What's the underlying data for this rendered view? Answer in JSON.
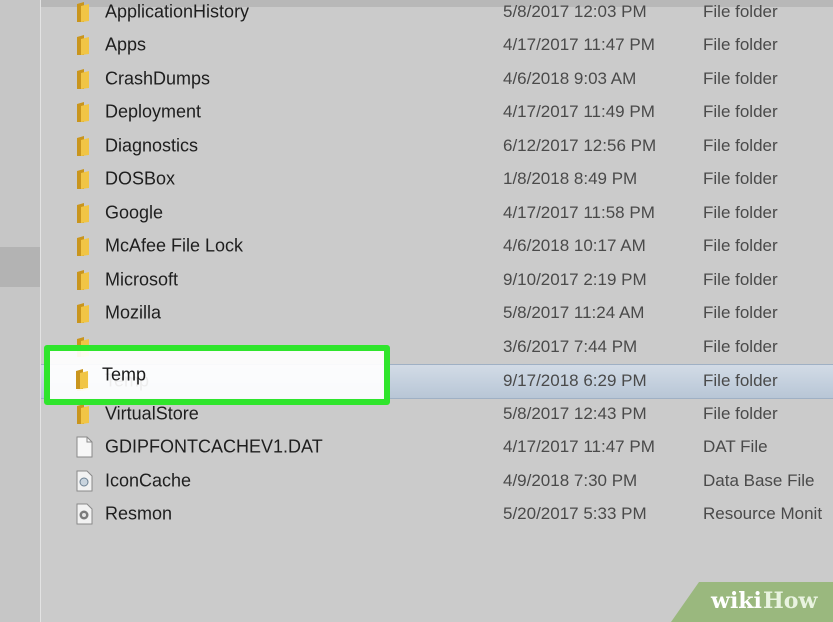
{
  "file_list": {
    "rows": [
      {
        "name": "ApplicationHistory",
        "date": "5/8/2017 12:03 PM",
        "type": "File folder",
        "icon": "folder-icon"
      },
      {
        "name": "Apps",
        "date": "4/17/2017 11:47 PM",
        "type": "File folder",
        "icon": "folder-icon"
      },
      {
        "name": "CrashDumps",
        "date": "4/6/2018 9:03 AM",
        "type": "File folder",
        "icon": "folder-icon"
      },
      {
        "name": "Deployment",
        "date": "4/17/2017 11:49 PM",
        "type": "File folder",
        "icon": "folder-icon"
      },
      {
        "name": "Diagnostics",
        "date": "6/12/2017 12:56 PM",
        "type": "File folder",
        "icon": "folder-icon"
      },
      {
        "name": "DOSBox",
        "date": "1/8/2018 8:49 PM",
        "type": "File folder",
        "icon": "folder-icon"
      },
      {
        "name": "Google",
        "date": "4/17/2017 11:58 PM",
        "type": "File folder",
        "icon": "folder-icon"
      },
      {
        "name": "McAfee File Lock",
        "date": "4/6/2018 10:17 AM",
        "type": "File folder",
        "icon": "folder-icon"
      },
      {
        "name": "Microsoft",
        "date": "9/10/2017 2:19 PM",
        "type": "File folder",
        "icon": "folder-icon"
      },
      {
        "name": "Mozilla",
        "date": "5/8/2017 11:24 AM",
        "type": "File folder",
        "icon": "folder-icon"
      },
      {
        "name": "",
        "date": "3/6/2017 7:44 PM",
        "type": "File folder",
        "icon": "folder-icon"
      },
      {
        "name": "Temp",
        "date": "9/17/2018 6:29 PM",
        "type": "File folder",
        "icon": "folder-icon",
        "selected": true
      },
      {
        "name": "VirtualStore",
        "date": "5/8/2017 12:43 PM",
        "type": "File folder",
        "icon": "folder-icon"
      },
      {
        "name": "GDIPFONTCACHEV1.DAT",
        "date": "4/17/2017 11:47 PM",
        "type": "DAT File",
        "icon": "file-icon"
      },
      {
        "name": "IconCache",
        "date": "4/9/2018 7:30 PM",
        "type": "Data Base File",
        "icon": "database-file-icon"
      },
      {
        "name": "Resmon",
        "date": "5/20/2017 5:33 PM",
        "type": "Resource Monit",
        "icon": "resmon-file-icon"
      }
    ]
  },
  "highlight": {
    "label": "Temp",
    "color": "#2fe52c"
  },
  "watermark": {
    "wiki": "wiki",
    "how": "How"
  },
  "colors": {
    "selection": "#c6d2df",
    "folder": "#e8b93a",
    "background": "#cbcbcb"
  }
}
